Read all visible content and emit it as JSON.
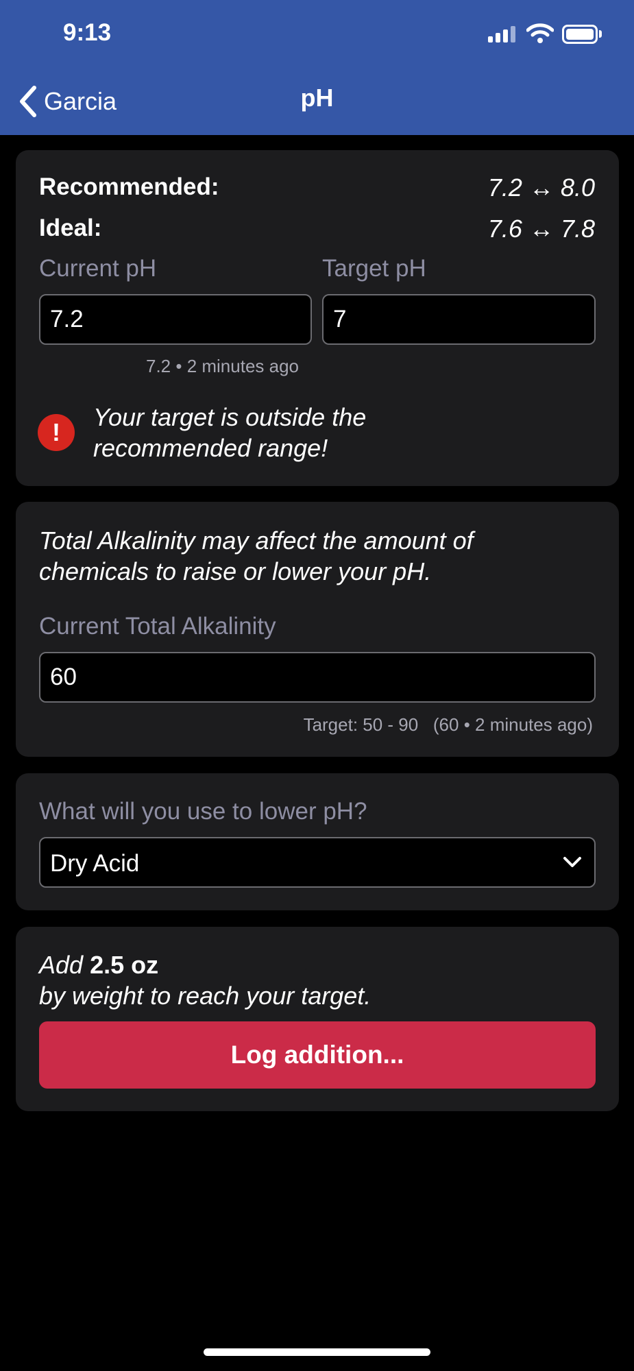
{
  "status_bar": {
    "time": "9:13"
  },
  "nav": {
    "back_label": "Garcia",
    "title": "pH"
  },
  "ranges": {
    "recommended_label": "Recommended:",
    "recommended_value": "7.2 ↔ 8.0",
    "ideal_label": "Ideal:",
    "ideal_value": "7.6 ↔ 7.8"
  },
  "ph_inputs": {
    "current_label": "Current pH",
    "current_value": "7.2",
    "target_label": "Target pH",
    "target_value": "7",
    "last_reading": "7.2 • 2 minutes ago"
  },
  "warning": {
    "text": "Your target is outside the recommended range!",
    "icon": "exclamation-icon"
  },
  "alkalinity": {
    "info": "Total Alkalinity may affect the amount of chemicals to raise or lower your pH.",
    "label": "Current Total Alkalinity",
    "value": "60",
    "caption": "Target: 50 - 90   (60 • 2 minutes ago)"
  },
  "chemical": {
    "label": "What will you use to lower pH?",
    "selected": "Dry Acid"
  },
  "result": {
    "add_word": "Add",
    "amount": "2.5 oz",
    "suffix": "by weight to reach your target.",
    "button_label": "Log addition..."
  },
  "colors": {
    "header": "#3557a7",
    "card": "#1c1c1e",
    "button": "#cb2b48",
    "warning": "#d7261f"
  }
}
